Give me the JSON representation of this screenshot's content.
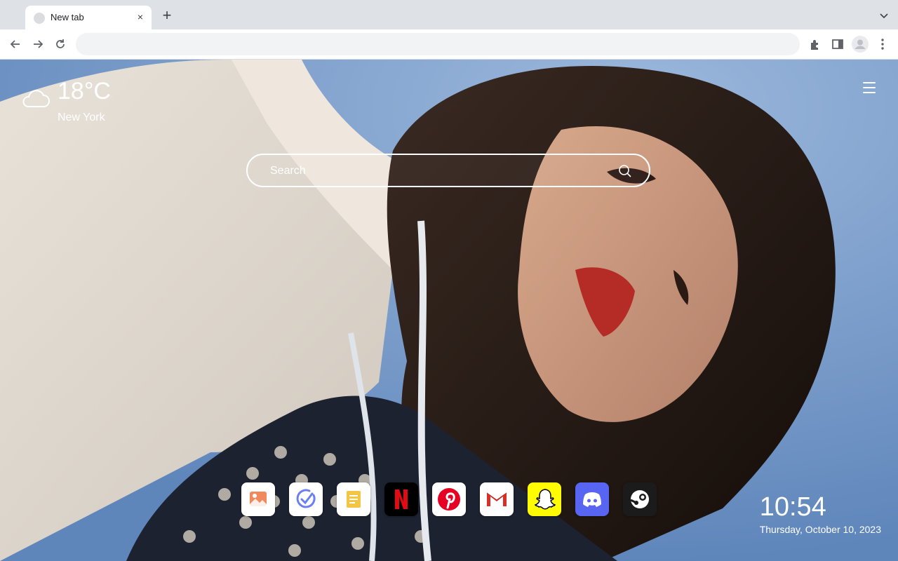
{
  "browser": {
    "tab_title": "New tab",
    "tab_close": "×",
    "new_tab": "+",
    "omnibox_value": ""
  },
  "weather": {
    "temperature": "18°C",
    "city": "New York",
    "icon": "cloud-icon"
  },
  "search": {
    "placeholder": "Search"
  },
  "shortcuts": [
    {
      "name": "image-app",
      "icon": "image-icon"
    },
    {
      "name": "tasks-app",
      "icon": "check-icon"
    },
    {
      "name": "notes-app",
      "icon": "note-icon"
    },
    {
      "name": "netflix",
      "icon": "netflix-icon"
    },
    {
      "name": "pinterest",
      "icon": "pinterest-icon"
    },
    {
      "name": "gmail",
      "icon": "gmail-icon"
    },
    {
      "name": "snapchat",
      "icon": "snapchat-icon"
    },
    {
      "name": "discord",
      "icon": "discord-icon"
    },
    {
      "name": "steam",
      "icon": "steam-icon"
    }
  ],
  "clock": {
    "time": "10:54",
    "date": "Thursday, October 10, 2023"
  },
  "colors": {
    "netflix": "#000000",
    "netflix_accent": "#e50914",
    "pinterest": "#e60023",
    "snapchat": "#fffc00",
    "discord": "#5865f2",
    "steam": "#1b1b1b"
  }
}
